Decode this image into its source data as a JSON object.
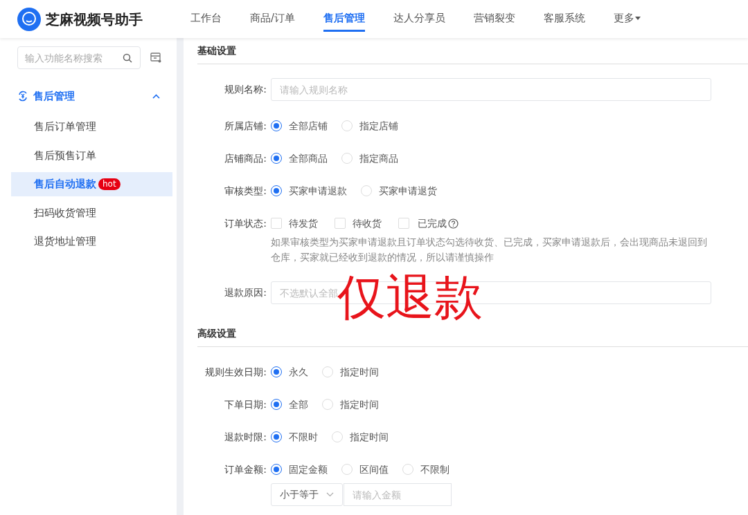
{
  "app": {
    "title": "芝麻视频号助手"
  },
  "nav": [
    {
      "label": "工作台",
      "selected": false
    },
    {
      "label": "商品/订单",
      "selected": false
    },
    {
      "label": "售后管理",
      "selected": true
    },
    {
      "label": "达人分享员",
      "selected": false
    },
    {
      "label": "营销裂变",
      "selected": false
    },
    {
      "label": "客服系统",
      "selected": false
    },
    {
      "label": "更多",
      "selected": false,
      "dropdown": true
    }
  ],
  "sidebar": {
    "search": {
      "placeholder": "输入功能名称搜索"
    },
    "group": {
      "label": "售后管理",
      "expanded": true,
      "items": [
        {
          "label": "售后订单管理",
          "selected": false
        },
        {
          "label": "售后预售订单",
          "selected": false
        },
        {
          "label": "售后自动退款",
          "selected": true,
          "badge": "hot"
        },
        {
          "label": "扫码收货管理",
          "selected": false
        },
        {
          "label": "退货地址管理",
          "selected": false
        }
      ]
    }
  },
  "sections": [
    {
      "title": "基础设置",
      "fields": [
        {
          "kind": "text",
          "label": "规则名称:",
          "placeholder": "请输入规则名称"
        },
        {
          "kind": "radio",
          "label": "所属店铺:",
          "options": [
            {
              "label": "全部店铺",
              "selected": true
            },
            {
              "label": "指定店铺",
              "selected": false
            }
          ]
        },
        {
          "kind": "radio",
          "label": "店铺商品:",
          "options": [
            {
              "label": "全部商品",
              "selected": true
            },
            {
              "label": "指定商品",
              "selected": false
            }
          ]
        },
        {
          "kind": "radio",
          "label": "审核类型:",
          "options": [
            {
              "label": "买家申请退款",
              "selected": true
            },
            {
              "label": "买家申请退货",
              "selected": false
            }
          ]
        },
        {
          "kind": "checkbox",
          "label": "订单状态:",
          "options": [
            {
              "label": "待发货",
              "checked": false
            },
            {
              "label": "待收货",
              "checked": false
            },
            {
              "label": "已完成",
              "checked": false,
              "help": true
            }
          ],
          "note": "如果审核类型为买家申请退款且订单状态勾选待收货、已完成，买家申请退款后，会出现商品未退回到仓库，买家就已经收到退款的情况，所以请谨慎操作"
        },
        {
          "kind": "text",
          "label": "退款原因:",
          "placeholder": "不选默认全部"
        }
      ]
    },
    {
      "title": "高级设置",
      "fields": [
        {
          "kind": "radio",
          "label": "规则生效日期:",
          "options": [
            {
              "label": "永久",
              "selected": true
            },
            {
              "label": "指定时间",
              "selected": false
            }
          ]
        },
        {
          "kind": "radio",
          "label": "下单日期:",
          "options": [
            {
              "label": "全部",
              "selected": true
            },
            {
              "label": "指定时间",
              "selected": false
            }
          ]
        },
        {
          "kind": "radio",
          "label": "退款时限:",
          "options": [
            {
              "label": "不限时",
              "selected": true
            },
            {
              "label": "指定时间",
              "selected": false
            }
          ]
        },
        {
          "kind": "radio",
          "label": "订单金额:",
          "options": [
            {
              "label": "固定金额",
              "selected": true
            },
            {
              "label": "区间值",
              "selected": false
            },
            {
              "label": "不限制",
              "selected": false
            }
          ],
          "amount": {
            "operator": "小于等于",
            "placeholder": "请输入金额"
          }
        }
      ]
    }
  ],
  "annotation": "仅退款"
}
